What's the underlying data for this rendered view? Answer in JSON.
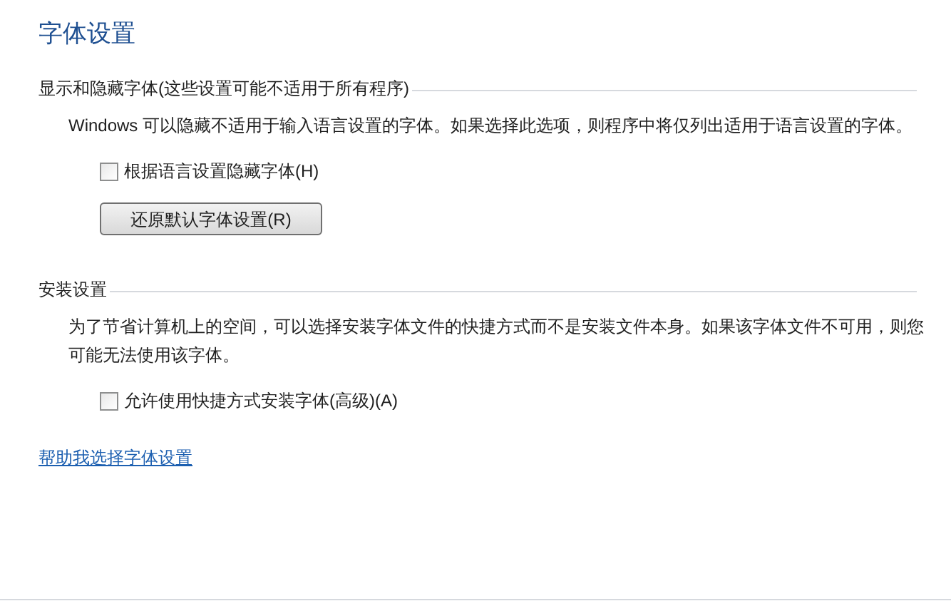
{
  "title": "字体设置",
  "sections": [
    {
      "heading": "显示和隐藏字体(这些设置可能不适用于所有程序)",
      "description": "Windows 可以隐藏不适用于输入语言设置的字体。如果选择此选项，则程序中将仅列出适用于语言设置的字体。",
      "checkbox": {
        "label": "根据语言设置隐藏字体(H)",
        "checked": false
      },
      "button": "还原默认字体设置(R)"
    },
    {
      "heading": "安装设置",
      "description": "为了节省计算机上的空间，可以选择安装字体文件的快捷方式而不是安装文件本身。如果该字体文件不可用，则您可能无法使用该字体。",
      "checkbox": {
        "label": "允许使用快捷方式安装字体(高级)(A)",
        "checked": false
      }
    }
  ],
  "help_link": "帮助我选择字体设置"
}
